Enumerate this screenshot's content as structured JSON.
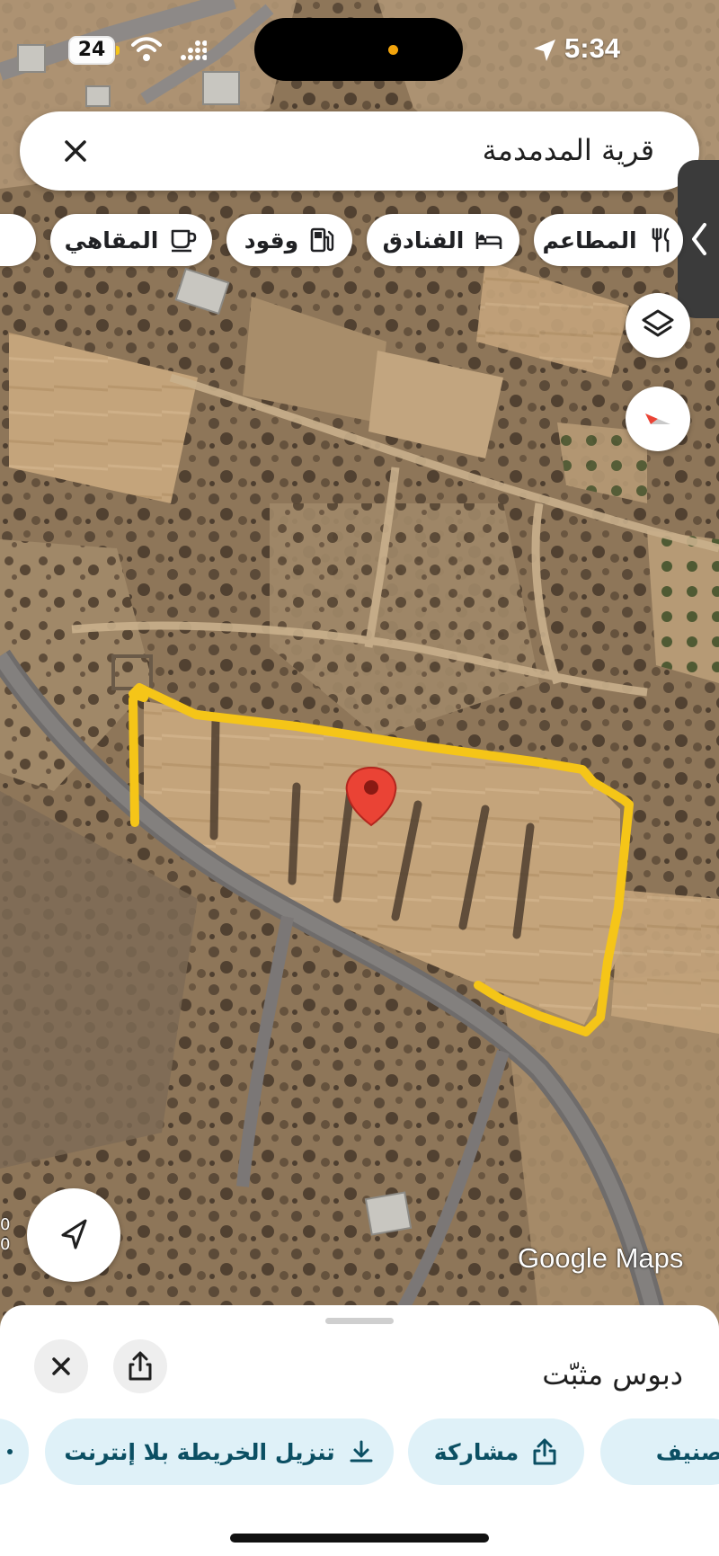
{
  "status_bar": {
    "battery_level": "24",
    "time": "5:34"
  },
  "search": {
    "query": "قرية المدمدمة"
  },
  "categories": [
    {
      "label": "المطاعم",
      "icon": "restaurant-icon"
    },
    {
      "label": "الفنادق",
      "icon": "hotel-icon"
    },
    {
      "label": "وقود",
      "icon": "gas-station-icon"
    },
    {
      "label": "المقاهي",
      "icon": "cafe-icon"
    },
    {
      "label": "",
      "icon": "shopping-cart-icon"
    }
  ],
  "map": {
    "attribution": "Google Maps",
    "boundary_color": "#f5c518",
    "pin_color": "#ea4335",
    "scale_fragment": [
      "0",
      "0"
    ]
  },
  "place_sheet": {
    "title": "دبوس مثبّت",
    "actions": [
      {
        "label": "تنزيل الخريطة بلا إنترنت",
        "icon": "download-icon"
      },
      {
        "label": "مشاركة",
        "icon": "share-icon"
      },
      {
        "label": "تصنيف",
        "icon": "bookmark-icon"
      }
    ]
  },
  "colors": {
    "chip_text": "#202124",
    "action_bg": "#dff1f8",
    "action_text": "#0b4f63"
  }
}
